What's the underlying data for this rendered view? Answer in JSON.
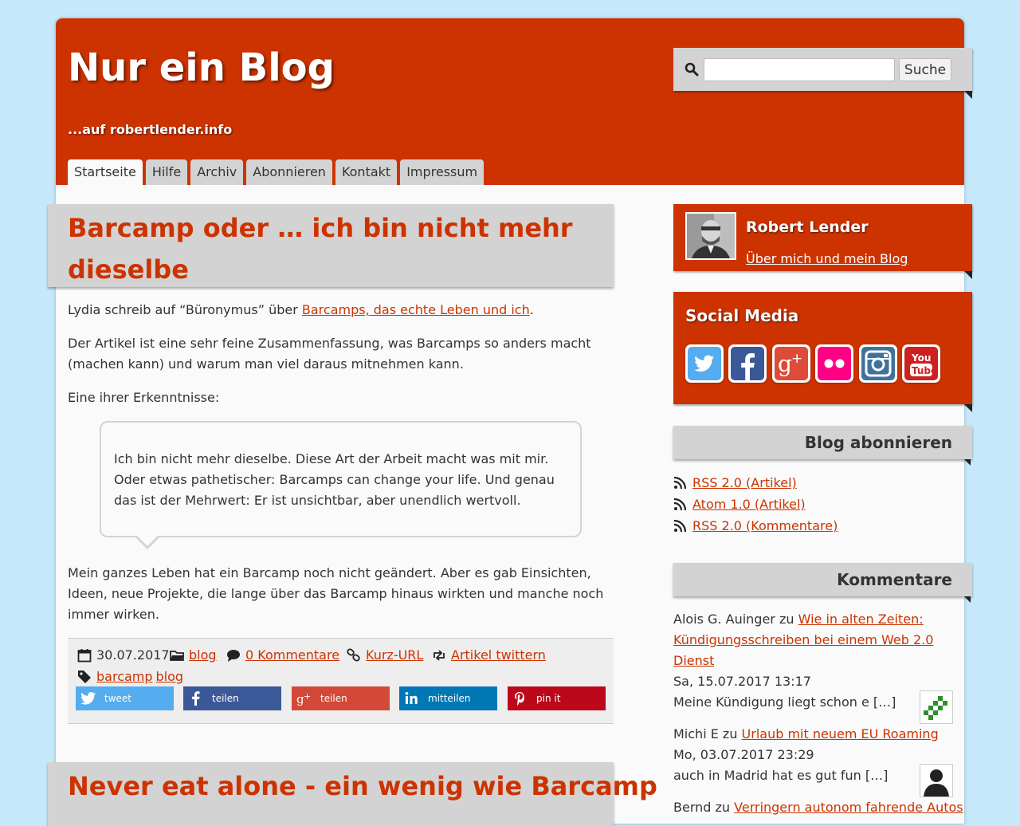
{
  "site": {
    "title": "Nur ein Blog",
    "tagline": "...auf robertlender.info"
  },
  "nav": {
    "tabs": [
      "Startseite",
      "Hilfe",
      "Archiv",
      "Abonnieren",
      "Kontakt",
      "Impressum"
    ],
    "active": "Startseite"
  },
  "search": {
    "placeholder": "",
    "button_label": "Suche"
  },
  "posts": [
    {
      "title": "Barcamp oder … ich bin nicht mehr dieselbe",
      "intro_prefix": "Lydia schreib auf “Büronymus” über ",
      "intro_link": "Barcamps, das echte Leben und ich",
      "intro_suffix": ".",
      "para2": "Der Artikel ist eine sehr feine Zusammenfassung, was Barcamps so anders macht (machen kann) und warum man viel daraus mitnehmen kann.",
      "para3": "Eine ihrer Erkenntnisse:",
      "quote": "Ich bin nicht mehr dieselbe. Diese Art der Arbeit macht was mit mir. Oder etwas pathetischer: Barcamps can change your life. Und genau das ist der Mehrwert: Er ist unsichtbar, aber unendlich wertvoll.",
      "para4": "Mein ganzes Leben hat ein Barcamp noch nicht geändert. Aber es gab Einsichten, Ideen, neue Projekte, die lange über das Barcamp hinaus wirkten und manche noch immer wirken.",
      "meta": {
        "date": "30.07.2017",
        "category": "blog",
        "comments": "0 Kommentare",
        "short_url": "Kurz-URL",
        "tweet": "Artikel twittern",
        "tags": [
          "barcamp",
          "blog"
        ]
      },
      "share": [
        {
          "label": "tweet",
          "icon": "twitter-icon",
          "color": "#55acee"
        },
        {
          "label": "teilen",
          "icon": "facebook-icon",
          "color": "#3b5998"
        },
        {
          "label": "teilen",
          "icon": "googleplus-icon",
          "color": "#d34836"
        },
        {
          "label": "mitteilen",
          "icon": "linkedin-icon",
          "color": "#0077b5"
        },
        {
          "label": "pin it",
          "icon": "pinterest-icon",
          "color": "#bd081c"
        }
      ]
    },
    {
      "title": "Never eat alone - ein wenig wie Barcamp"
    }
  ],
  "sidebar": {
    "author": {
      "name": "Robert Lender",
      "link": "Über mich und mein Blog"
    },
    "social": {
      "title": "Social Media",
      "icons": [
        "twitter-icon",
        "facebook-icon",
        "googleplus-icon",
        "flickr-icon",
        "instagram-icon",
        "youtube-icon"
      ]
    },
    "subscribe": {
      "title": "Blog abonnieren",
      "feeds": [
        "RSS 2.0 (Artikel)",
        "Atom 1.0 (Artikel)",
        "RSS 2.0 (Kommentare)"
      ]
    },
    "comments": {
      "title": "Kommentare",
      "items": [
        {
          "author": "Alois G. Auinger",
          "connector": " zu ",
          "post": "Wie in alten Zeiten: Kündigungsschreiben bei einem Web 2.0 Dienst",
          "date": "Sa, 15.07.2017 13:17",
          "excerpt": "Meine Kündigung liegt schon e […]"
        },
        {
          "author": "Michi E",
          "connector": " zu ",
          "post": "Urlaub mit neuem EU Roaming",
          "date": "Mo, 03.07.2017 23:29",
          "excerpt": "auch in Madrid hat es gut fun […]"
        },
        {
          "author": "Bernd",
          "connector": " zu ",
          "post": "Verringern autonom fahrende Autos"
        }
      ]
    }
  },
  "colors": {
    "accent": "#cc3300",
    "background": "#c5e8fb",
    "panel_gray": "#d3d3d3"
  }
}
